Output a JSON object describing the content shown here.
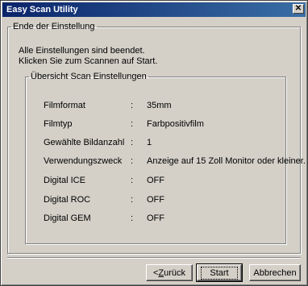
{
  "window": {
    "title": "Easy Scan Utility",
    "close_glyph": "✕"
  },
  "group_main": {
    "legend": "Ende der Einstellung"
  },
  "intro": {
    "line1": "Alle Einstellungen sind beendet.",
    "line2": "Klicken Sie zum Scannen auf Start."
  },
  "group_summary": {
    "legend": "Übersicht  Scan Einstellungen",
    "rows": [
      {
        "label": "Filmformat",
        "colon": ":",
        "value": "35mm"
      },
      {
        "label": "Filmtyp",
        "colon": ":",
        "value": "Farbpositivfilm"
      },
      {
        "label": "Gewählte Bildanzahl",
        "colon": ":",
        "value": "1"
      },
      {
        "label": "Verwendungszweck",
        "colon": ":",
        "value": "Anzeige auf 15 Zoll Monitor oder kleiner."
      },
      {
        "label": "Digital ICE",
        "colon": ":",
        "value": "OFF"
      },
      {
        "label": "Digital ROC",
        "colon": ":",
        "value": "OFF"
      },
      {
        "label": "Digital GEM",
        "colon": ":",
        "value": "OFF"
      }
    ]
  },
  "buttons": {
    "back_prefix": "< ",
    "back_hotkey": "Z",
    "back_rest": "urück",
    "start": "Start",
    "cancel": "Abbrechen"
  }
}
